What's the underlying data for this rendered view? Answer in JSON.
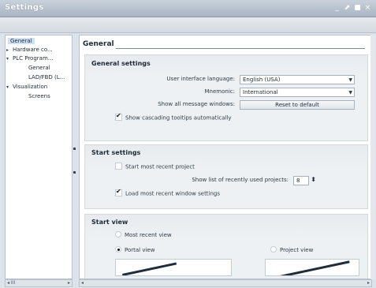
{
  "window": {
    "title": "Settings",
    "controls": [
      "_",
      "⬈",
      "■",
      "×"
    ]
  },
  "tree": {
    "items": [
      {
        "label": "General",
        "level": 1,
        "arrow": "",
        "selected": true
      },
      {
        "label": "Hardware co...",
        "level": 0,
        "arrow": "▸",
        "selected": false
      },
      {
        "label": "PLC Program...",
        "level": 0,
        "arrow": "▾",
        "selected": false
      },
      {
        "label": "General",
        "level": 1,
        "arrow": "",
        "selected": false
      },
      {
        "label": "LAD/FBD (L...",
        "level": 1,
        "arrow": "",
        "selected": false
      },
      {
        "label": "Visualization",
        "level": 0,
        "arrow": "▾",
        "selected": false
      },
      {
        "label": "Screens",
        "level": 1,
        "arrow": "",
        "selected": false
      }
    ],
    "hscroll": {
      "left": "◂ III",
      "right": "▸"
    }
  },
  "main": {
    "title": "General",
    "general_settings": {
      "title": "General settings",
      "language_label": "User interface language:",
      "language_value": "English (USA)",
      "mnemonic_label": "Mnemonic:",
      "mnemonic_value": "International",
      "message_windows_label": "Show all message windows:",
      "reset_button": "Reset to default",
      "cascading_tooltips_label": "Show cascading tooltips automatically",
      "cascading_tooltips_checked": true
    },
    "start_settings": {
      "title": "Start settings",
      "start_recent_label": "Start most recent project",
      "start_recent_checked": false,
      "recent_list_label": "Show list of recently used projects:",
      "recent_list_value": "8",
      "load_window_label": "Load most recent window settings",
      "load_window_checked": true
    },
    "start_view": {
      "title": "Start view",
      "most_recent_label": "Most recent view",
      "portal_label": "Portal view",
      "project_label": "Project view",
      "selected": "Portal view"
    },
    "hscroll": {
      "left": "◂",
      "right": "▸"
    }
  },
  "colors": {
    "accent": "#cfe0f1",
    "title_bar": "#a9b5c2"
  }
}
